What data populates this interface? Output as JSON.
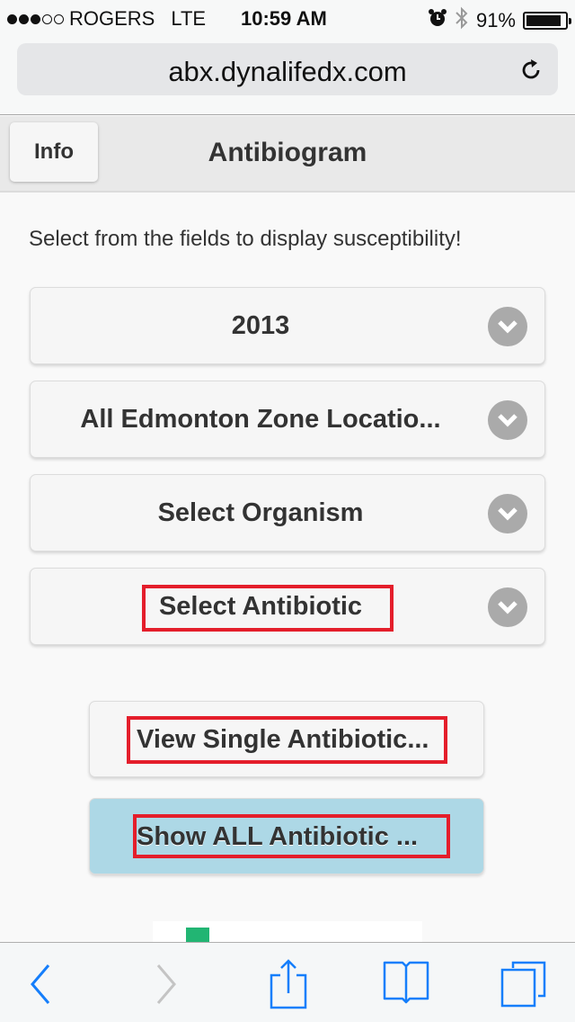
{
  "status_bar": {
    "signal_filled": 3,
    "signal_total": 5,
    "carrier": "ROGERS",
    "network": "LTE",
    "time": "10:59 AM",
    "battery_percent": "91%",
    "battery_level": 0.91,
    "icons": [
      "alarm-icon",
      "bluetooth-icon",
      "battery-icon"
    ]
  },
  "browser": {
    "url": "abx.dynalifedx.com",
    "reload_icon": "reload-icon",
    "toolbar": {
      "back": "back-icon",
      "forward": "forward-icon",
      "share": "share-icon",
      "bookmarks": "bookmarks-icon",
      "tabs": "tabs-icon"
    }
  },
  "header": {
    "info_label": "Info",
    "title": "Antibiogram"
  },
  "main": {
    "intro": "Select from the fields to display susceptibility!",
    "selects": [
      {
        "name": "year",
        "value": "2013"
      },
      {
        "name": "location",
        "value": "All Edmonton Zone Locatio..."
      },
      {
        "name": "organism",
        "value": "Select Organism"
      },
      {
        "name": "antibiotic",
        "value": "Select Antibiotic"
      }
    ],
    "buttons": {
      "view_single": "View Single Antibiotic...",
      "show_all": "Show ALL Antibiotic ..."
    }
  },
  "colors": {
    "highlight_box": "#e41e2b",
    "show_all_bg": "#add8e6",
    "ios_blue": "#157efb",
    "chevron_bg": "#aaaaaa",
    "legend_green": "#22b573"
  }
}
